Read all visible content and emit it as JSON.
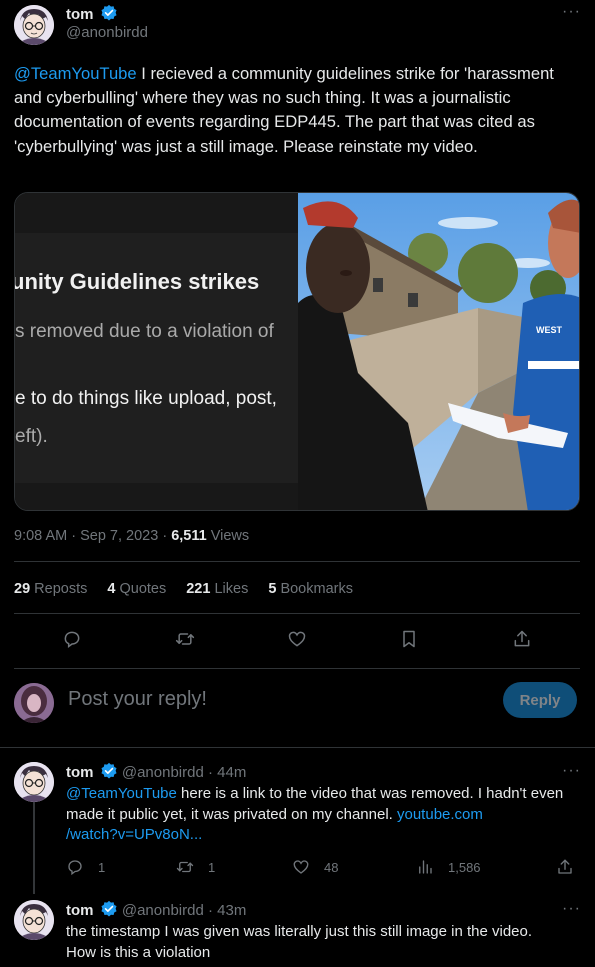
{
  "tweet": {
    "author_name": "tom",
    "author_handle": "@anonbirdd",
    "text_mention": "@TeamYouTube",
    "text_rest": " I recieved a community guidelines strike for 'harassment and cyberbulling' where they was no such thing. It was a journalistic documentation of events regarding EDP445. The part that was cited as 'cyberbullying' was just a still image. Please reinstate my video.",
    "media_screenshot": {
      "title": "unity Guidelines strikes",
      "line1": "s removed due to a violation of",
      "line2": "e to do things like upload, post,",
      "line3": "eft)."
    },
    "jersey_text": "WEST",
    "time": "9:08 AM · Sep 7, 2023 · ",
    "views_count": "6,511",
    "views_label": " Views",
    "stats": {
      "reposts_count": "29",
      "reposts_label": "Reposts",
      "quotes_count": "4",
      "quotes_label": "Quotes",
      "likes_count": "221",
      "likes_label": "Likes",
      "bookmarks_count": "5",
      "bookmarks_label": "Bookmarks"
    }
  },
  "reply_box": {
    "placeholder": "Post your reply!",
    "button_label": "Reply"
  },
  "replies": [
    {
      "name": "tom",
      "handle": "@anonbirdd",
      "time": "· 44m",
      "mention": "@TeamYouTube",
      "text": " here is a link to the video that was removed. I hadn't even made it public yet, it was privated on my channel. ",
      "link": "youtube.com\n/watch?v=UPv8oN...",
      "replies_count": "1",
      "reposts_count": "1",
      "likes_count": "48",
      "views_count": "1,586"
    },
    {
      "name": "tom",
      "handle": "@anonbirdd",
      "time": "· 43m",
      "text": "the timestamp I was given was literally just this still image in the video. How is this a violation"
    }
  ],
  "icons": [
    "verified-badge-icon",
    "more-icon",
    "reply-icon",
    "repost-icon",
    "like-icon",
    "bookmark-icon",
    "share-icon",
    "views-icon"
  ],
  "colors": {
    "accent": "#1d9bf0",
    "muted": "#71767b",
    "text": "#e7e9ea",
    "border": "#2f3336",
    "reply_button": "#0f4e78"
  }
}
